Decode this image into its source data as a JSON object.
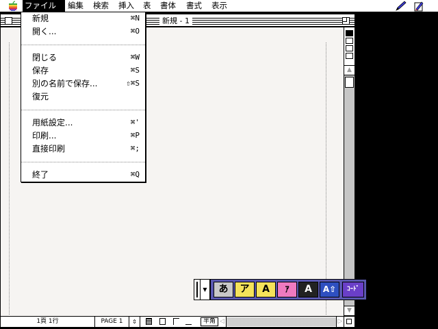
{
  "menubar": {
    "items": [
      "ファイル",
      "編集",
      "検索",
      "挿入",
      "表",
      "書体",
      "書式",
      "表示"
    ]
  },
  "window": {
    "title": "新規 - 1"
  },
  "file_menu": {
    "items": [
      {
        "label": "新規",
        "shortcut": "⌘N"
      },
      {
        "label": "開く...",
        "shortcut": "⌘O"
      },
      {
        "label": "閉じる",
        "shortcut": "⌘W"
      },
      {
        "label": "保存",
        "shortcut": "⌘S"
      },
      {
        "label": "別の名前で保存...",
        "shortcut": "⇧⌘S"
      },
      {
        "label": "復元",
        "shortcut": ""
      },
      {
        "label": "用紙設定...",
        "shortcut": "⌘'"
      },
      {
        "label": "印刷...",
        "shortcut": "⌘P"
      },
      {
        "label": "直接印刷",
        "shortcut": "⌘;"
      },
      {
        "label": "終了",
        "shortcut": "⌘Q"
      }
    ]
  },
  "status": {
    "position": "1頁 1行",
    "page": "PAGE 1",
    "unit": "半角"
  },
  "ime_palette": {
    "buttons": [
      {
        "label": "あ",
        "color": "#c8c8c8"
      },
      {
        "label": "ア",
        "color": "#f5e25a"
      },
      {
        "label": "A",
        "color": "#f5e25a"
      },
      {
        "label": "ｱ",
        "color": "#f07ac0"
      },
      {
        "label": "A",
        "color": "#222222"
      },
      {
        "label": "A⇧",
        "color": "#2e4fc0"
      },
      {
        "label": "ｺｰﾄﾞ",
        "color": "#6a3fc8"
      }
    ]
  },
  "icons": [
    "apple-icon",
    "pen-icon",
    "document-icon",
    "close-box-icon",
    "zoom-box-icon",
    "scroll-up-arrow-icon",
    "scroll-down-arrow-icon"
  ]
}
